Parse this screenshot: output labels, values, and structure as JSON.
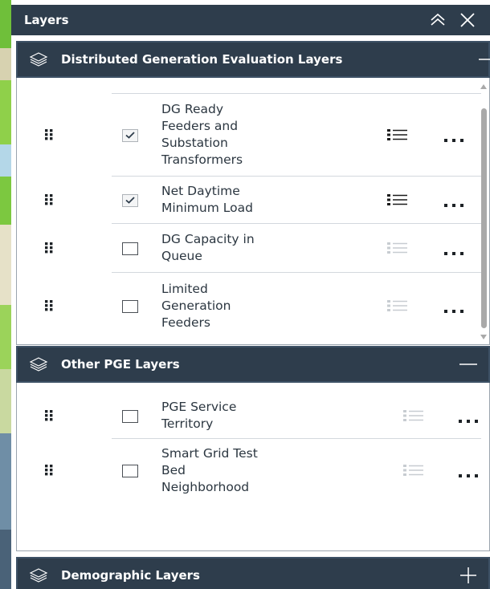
{
  "panel": {
    "title": "Layers",
    "collapse_icon": "double-chevron-up-icon",
    "close_icon": "close-icon"
  },
  "groups": [
    {
      "title": "Distributed Generation Evaluation Layers",
      "expanded": true,
      "toggle_icon": "minus-icon",
      "layers": [
        {
          "name": "DG Ready Feeders and Substation Transformers",
          "lines": [
            "DG Ready",
            "Feeders and",
            "Substation",
            "Transformers"
          ],
          "checked": true,
          "legend_active": true
        },
        {
          "name": "Net Daytime Minimum Load",
          "lines": [
            "Net Daytime",
            "Minimum Load"
          ],
          "checked": true,
          "legend_active": true
        },
        {
          "name": "DG Capacity in Queue",
          "lines": [
            "DG Capacity in",
            "Queue"
          ],
          "checked": false,
          "legend_active": false
        },
        {
          "name": "Limited Generation Feeders",
          "lines": [
            "Limited",
            "Generation",
            "Feeders"
          ],
          "checked": false,
          "legend_active": false
        }
      ]
    },
    {
      "title": "Other PGE Layers",
      "expanded": true,
      "toggle_icon": "minus-icon",
      "layers": [
        {
          "name": "PGE Service Territory",
          "lines": [
            "PGE Service",
            "Territory"
          ],
          "checked": false,
          "legend_active": false
        },
        {
          "name": "Smart Grid Test Bed Neighborhood",
          "lines": [
            "Smart Grid Test",
            "Bed",
            "Neighborhood"
          ],
          "checked": false,
          "legend_active": false
        }
      ]
    },
    {
      "title": "Demographic Layers",
      "expanded": false,
      "toggle_icon": "plus-icon",
      "layers": []
    }
  ],
  "colors": {
    "header_bg": "#2e3d4c",
    "header_text": "#ffffff",
    "body_bg": "#ffffff",
    "text": "#2b3640",
    "separator": "#d3d8dd",
    "legend_inactive": "#c7ccd1",
    "legend_active": "#1a1a1a",
    "scrollbar_thumb": "#a9a9a9"
  }
}
